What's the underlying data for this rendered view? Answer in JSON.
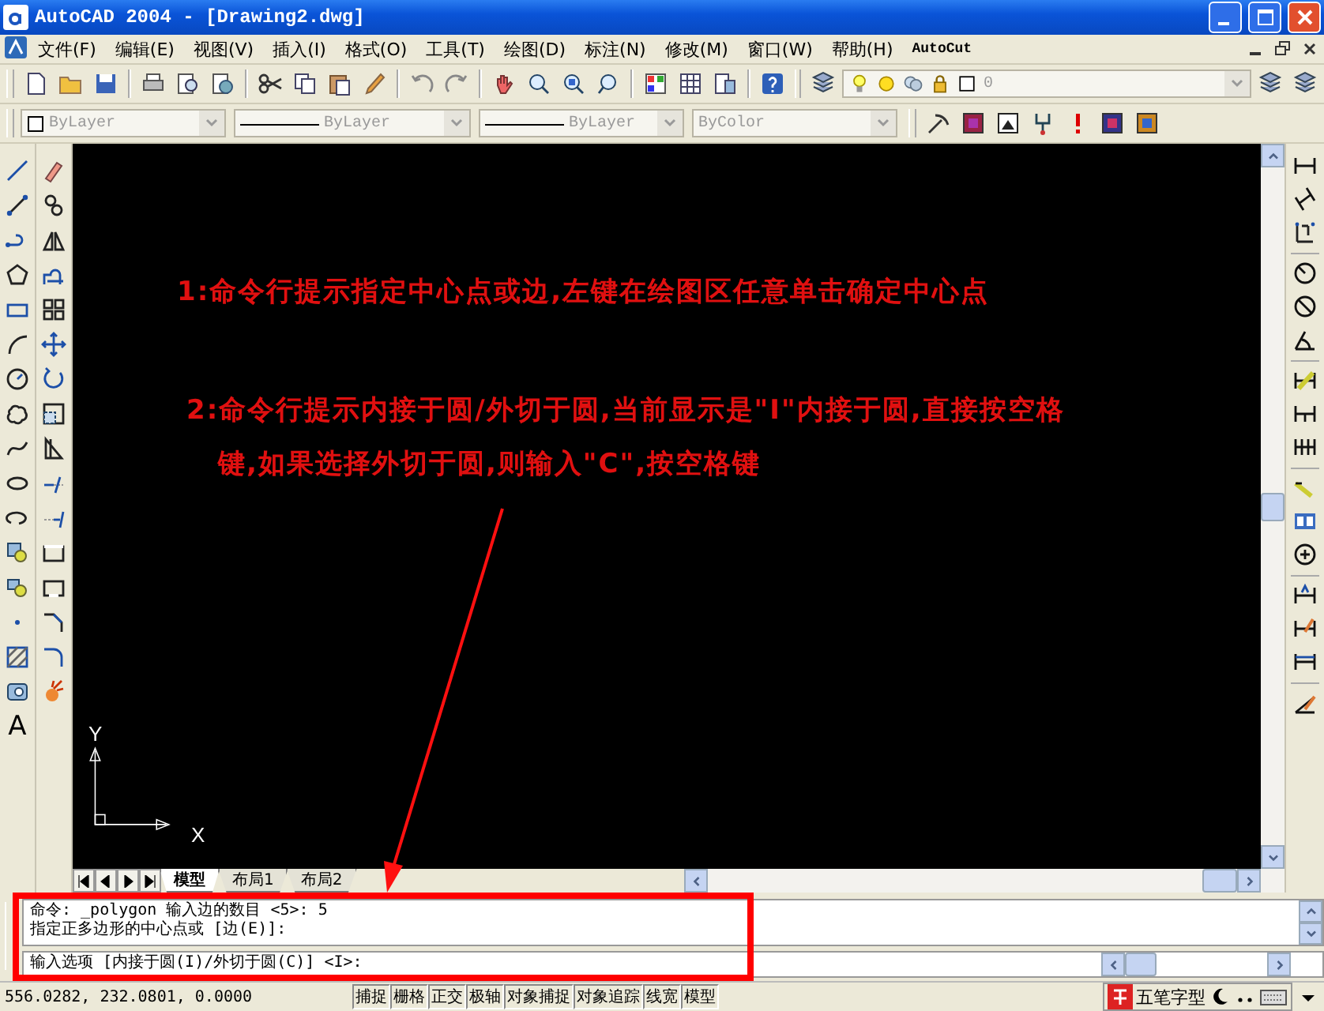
{
  "window": {
    "title": "AutoCAD 2004 - [Drawing2.dwg]"
  },
  "menu": [
    "文件(F)",
    "编辑(E)",
    "视图(V)",
    "插入(I)",
    "格式(O)",
    "工具(T)",
    "绘图(D)",
    "标注(N)",
    "修改(M)",
    "窗口(W)",
    "帮助(H)",
    "AutoCut"
  ],
  "layer_field": {
    "value": "0"
  },
  "property_fields": [
    {
      "kind": "color",
      "value": "ByLayer"
    },
    {
      "kind": "linetype",
      "value": "ByLayer"
    },
    {
      "kind": "lineweight",
      "value": "ByLayer"
    },
    {
      "kind": "plotstyle",
      "value": "ByColor"
    }
  ],
  "draw_toolbar": {
    "text_tool": "A"
  },
  "canvas": {
    "annotations": [
      "1:命令行提示指定中心点或边,左键在绘图区任意单击确定中心点",
      "2:命令行提示内接于圆/外切于圆,当前显示是\"I\"内接于圆,直接按空格",
      "键,如果选择外切于圆,则输入\"C\",按空格键"
    ],
    "ucs": {
      "y_label": "Y",
      "x_label": "X"
    }
  },
  "layout_tabs": [
    {
      "label": "模型",
      "selected": true
    },
    {
      "label": "布局1",
      "selected": false
    },
    {
      "label": "布局2",
      "selected": false
    }
  ],
  "command_history": [
    "命令: _polygon 输入边的数目 <5>: 5",
    "指定正多边形的中心点或 [边(E)]:"
  ],
  "command_prompt": "输入选项 [内接于圆(I)/外切于圆(C)] <I>:",
  "status_bar": {
    "coordinates": "556.0282, 232.0801, 0.0000",
    "toggles": [
      "捕捉",
      "栅格",
      "正交",
      "极轴",
      "对象捕捉",
      "对象追踪",
      "线宽",
      "模型"
    ],
    "input_method": "五笔字型"
  }
}
